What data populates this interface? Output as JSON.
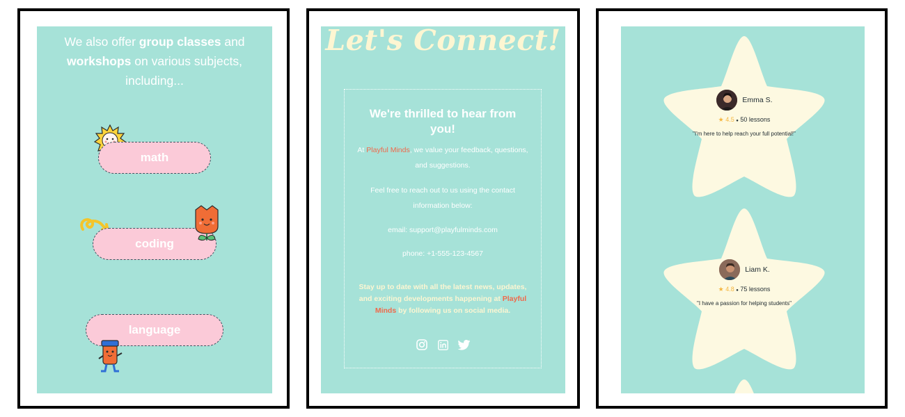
{
  "panel_groups": {
    "intro_parts": [
      "We also offer ",
      "group classes",
      " and ",
      "workshops",
      " on various subjects, including..."
    ],
    "subjects": [
      "math",
      "coding",
      "language"
    ]
  },
  "connect": {
    "title": "Let's Connect!",
    "heading": "We're thrilled to hear from you!",
    "feedback_prefix": "At ",
    "brand": "Playful Minds",
    "feedback_suffix": ", we value your feedback, questions, and suggestions.",
    "reach_out": "Feel free to reach out to us using the contact information below:",
    "email": "email: support@playfulminds.com",
    "phone": "phone: +1-555-123-4567",
    "stay_prefix": "Stay up to date with all the latest news, updates, and exciting developments happening at ",
    "stay_brand": "Playful Minds",
    "stay_suffix": " by following us on social media.",
    "social_icons": [
      "instagram-icon",
      "linkedin-icon",
      "twitter-icon"
    ]
  },
  "tutors": [
    {
      "name": "Emma S.",
      "rating": "4.5",
      "separator": "●",
      "lessons": "50 lessons",
      "quote": "\"I'm here to help reach your full potential!\""
    },
    {
      "name": "Liam K.",
      "rating": "4.8",
      "separator": "●",
      "lessons": "75 lessons",
      "quote": "\"I have a passion for helping students\""
    }
  ],
  "colors": {
    "panel_bg": "#a6e2d8",
    "pill_bg": "#fbcad8",
    "accent": "#f0694b",
    "cream": "#fdf6d2",
    "star": "#fdf9e1",
    "rating_star": "#f5b640"
  }
}
